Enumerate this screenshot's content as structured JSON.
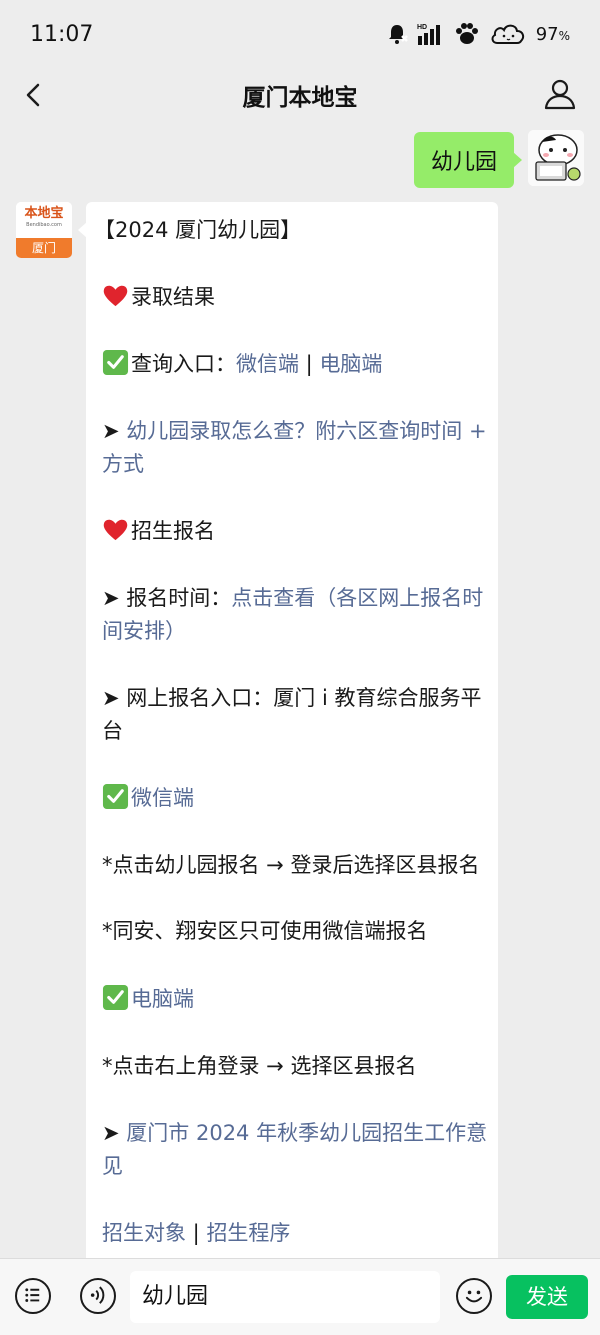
{
  "status_bar": {
    "time": "11:07",
    "battery": "97",
    "battery_unit": "%",
    "network_label": "HD"
  },
  "nav": {
    "title": "厦门本地宝"
  },
  "user_message": {
    "text": "幼儿园"
  },
  "bot": {
    "avatar_brand": "本地宝",
    "avatar_url": "Bendibao.com",
    "avatar_city": "厦门",
    "reply": {
      "heading": "【2024 厦门幼儿园】",
      "section1_title": "录取结果",
      "query_label": "查询入口：",
      "query_wechat": "微信端",
      "query_sep": " | ",
      "query_pc": "电脑端",
      "arrow": "➤",
      "link_check_method": "幼儿园录取怎么查？附六区查询时间 + 方式",
      "section2_title": "招生报名",
      "signup_time_label": "报名时间：",
      "signup_time_link": "点击查看",
      "signup_time_paren_open": "（",
      "signup_time_detail_link": "各区网上报名时间安排",
      "signup_time_paren_close": "）",
      "online_entry": "网上报名入口：厦门 i 教育综合服务平台",
      "wechat_heading": "微信端",
      "wechat_step1": "*点击幼儿园报名 → 登录后选择区县报名",
      "wechat_step2": "*同安、翔安区只可使用微信端报名",
      "pc_heading": "电脑端",
      "pc_step1": "*点击右上角登录 → 选择区县报名",
      "opinion_link": "厦门市 2024 年秋季幼儿园招生工作意见",
      "target_link": "招生对象",
      "bottom_sep": " | ",
      "procedure_link": "招生程序"
    }
  },
  "input_bar": {
    "input_value": "幼儿园",
    "send_label": "发送"
  },
  "colors": {
    "link": "#576b95",
    "bubble_green": "#95ec69",
    "send_green": "#07c160",
    "background": "#ededed"
  }
}
